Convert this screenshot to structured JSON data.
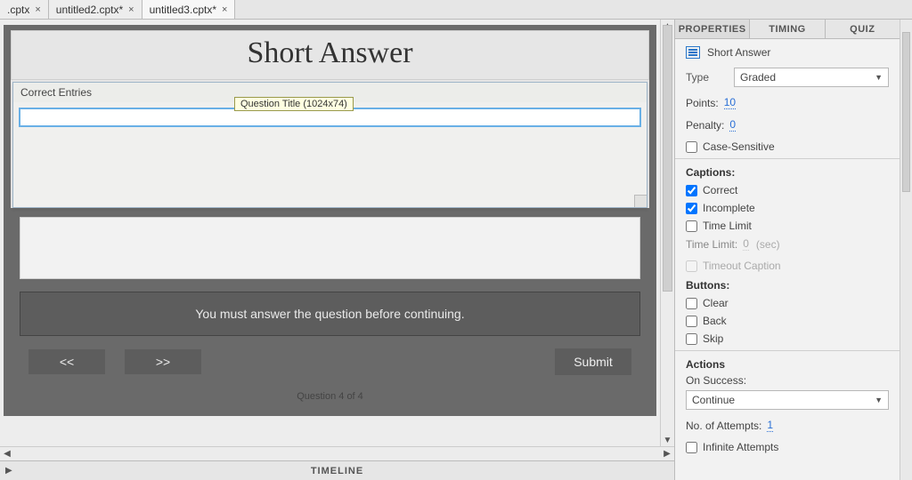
{
  "tabs": [
    {
      "label": ".cptx"
    },
    {
      "label": "untitled2.cptx*"
    },
    {
      "label": "untitled3.cptx*"
    }
  ],
  "canvas": {
    "question_title": "Short Answer",
    "entries_header": "Correct Entries",
    "tooltip": "Question Title (1024x74)",
    "message": "You must answer the question before continuing.",
    "prev_label": "<<",
    "next_label": ">>",
    "submit_label": "Submit",
    "progress": "Question 4 of 4"
  },
  "timeline_label": "TIMELINE",
  "right": {
    "tabs": {
      "properties": "PROPERTIES",
      "timing": "TIMING",
      "quiz": "QUIZ"
    },
    "object_name": "Short Answer",
    "type_label": "Type",
    "type_value": "Graded",
    "points_label": "Points:",
    "points_value": "10",
    "penalty_label": "Penalty:",
    "penalty_value": "0",
    "case_sensitive": "Case-Sensitive",
    "captions_title": "Captions:",
    "cap_correct": "Correct",
    "cap_incomplete": "Incomplete",
    "cap_timelimit": "Time Limit",
    "timelimit_label": "Time Limit:",
    "timelimit_value": "0",
    "timelimit_unit": "(sec)",
    "timeout_caption": "Timeout Caption",
    "buttons_title": "Buttons:",
    "btn_clear": "Clear",
    "btn_back": "Back",
    "btn_skip": "Skip",
    "actions_title": "Actions",
    "on_success_label": "On Success:",
    "on_success_value": "Continue",
    "attempts_label": "No. of Attempts:",
    "attempts_value": "1",
    "infinite": "Infinite Attempts"
  }
}
